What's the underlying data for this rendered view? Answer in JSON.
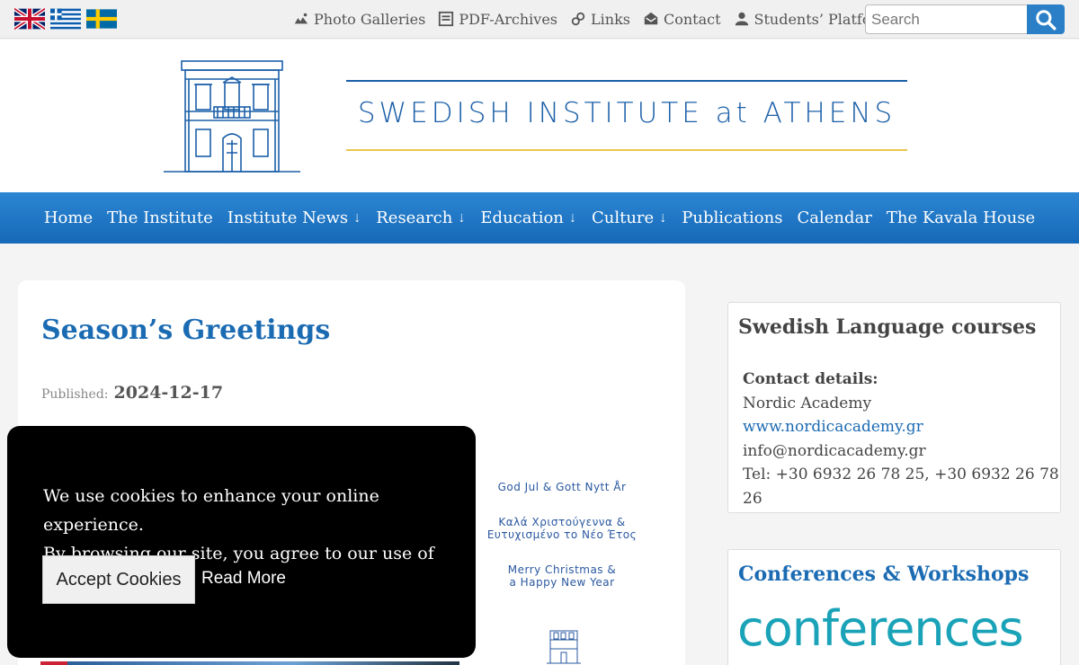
{
  "topbar": {
    "flags": [
      "flag-uk-icon",
      "flag-greece-icon",
      "flag-sweden-icon"
    ],
    "links": [
      {
        "label": "Photo Galleries",
        "icon": "camera-icon"
      },
      {
        "label": "PDF-Archives",
        "icon": "pdf-icon"
      },
      {
        "label": "Links",
        "icon": "link-icon"
      },
      {
        "label": "Contact",
        "icon": "mail-icon"
      },
      {
        "label": "Students’ Platform",
        "icon": "user-icon"
      }
    ],
    "search_placeholder": "Search"
  },
  "header": {
    "brand": "SWEDISH INSTITUTE at ATHENS"
  },
  "nav": {
    "items": [
      {
        "label": "Home"
      },
      {
        "label": "The Institute"
      },
      {
        "label": "Institute News",
        "arrow": "⇣"
      },
      {
        "label": "Research",
        "arrow": "⇣"
      },
      {
        "label": "Education",
        "arrow": "⇣"
      },
      {
        "label": "Culture",
        "arrow": "⇣"
      },
      {
        "label": "Publications"
      },
      {
        "label": "Calendar"
      },
      {
        "label": "The Kavala House"
      }
    ]
  },
  "article": {
    "title": "Season’s Greetings",
    "published_label": "Published:",
    "published_date": "2024-12-17",
    "greetings": [
      "God Jul & Gott Nytt År",
      "Καλά Χριστούγεννα &\nΕυτυχισμένο το Νέο Έτος",
      "Merry Christmas &\na Happy New Year"
    ]
  },
  "sidebar": {
    "language_courses": {
      "title": "Swedish Language courses",
      "contact_label": "Contact details:",
      "org": "Nordic Academy",
      "website": "www.nordicacademy.gr",
      "email": "info@nordicacademy.gr",
      "phone": "Tel: +30 6932 26 78 25, +30 6932 26 78 26"
    },
    "conferences": {
      "title": "Conferences & Workshops",
      "logo_text": "conferences"
    }
  },
  "cookie": {
    "line1": "We use cookies to enhance your online experience.",
    "line2": "By browsing our site, you agree to our use of cookies.",
    "accept_label": "Accept Cookies",
    "read_more_label": "Read More"
  },
  "colors": {
    "accent_blue": "#1b6bb3",
    "nav_blue": "#1e77c6",
    "gold": "#e8c84a"
  }
}
